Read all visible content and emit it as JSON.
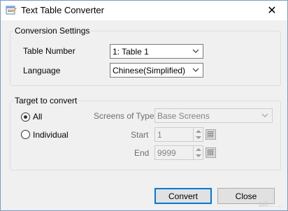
{
  "window": {
    "title": "Text Table Converter",
    "close_label": "✕"
  },
  "conversion_settings": {
    "legend": "Conversion Settings",
    "table_number_label": "Table Number",
    "table_number_value": "1: Table 1",
    "language_label": "Language",
    "language_value": "Chinese(Simplified)"
  },
  "target": {
    "legend": "Target to convert",
    "all_label": "All",
    "individual_label": "Individual",
    "selected": "All",
    "screens_of_type_label": "Screens of Type",
    "screens_of_type_value": "Base Screens",
    "start_label": "Start",
    "start_value": "1",
    "end_label": "End",
    "end_value": "9999"
  },
  "buttons": {
    "convert": "Convert",
    "close": "Close"
  },
  "watermark": "bili... ...",
  "colors": {
    "accent": "#0078d7",
    "window_bg": "#f0f0f0"
  }
}
